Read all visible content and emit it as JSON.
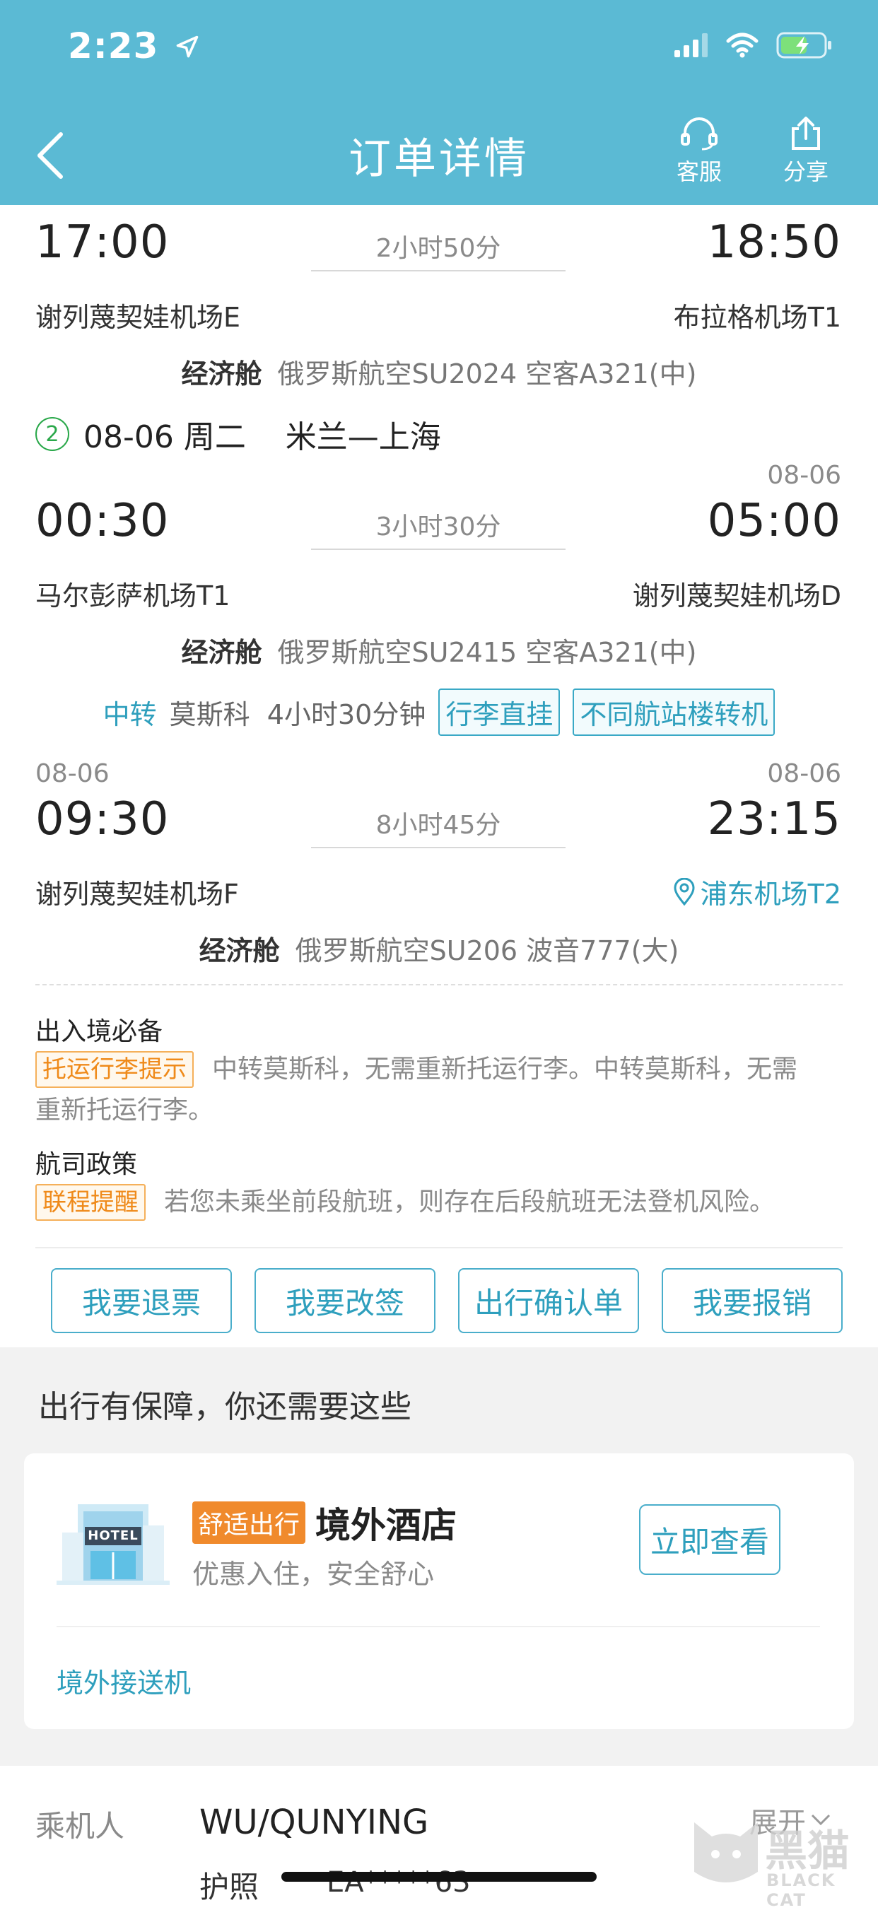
{
  "status": {
    "time": "2:23"
  },
  "header": {
    "title": "订单详情",
    "service_label": "客服",
    "share_label": "分享"
  },
  "segment1": {
    "dep_time": "17:00",
    "arr_time": "18:50",
    "duration": "2小时50分",
    "dep_airport": "谢列蔑契娃机场E",
    "arr_airport": "布拉格机场T1",
    "cabin": "经济舱",
    "flight": "俄罗斯航空SU2024  空客A321(中)"
  },
  "trip2": {
    "index": "2",
    "label": "08-06 周二    米兰—上海"
  },
  "segment2": {
    "arr_date": "08-06",
    "dep_time": "00:30",
    "arr_time": "05:00",
    "duration": "3小时30分",
    "dep_airport": "马尔彭萨机场T1",
    "arr_airport": "谢列蔑契娃机场D",
    "cabin": "经济舱",
    "flight": "俄罗斯航空SU2415  空客A321(中)"
  },
  "transfer": {
    "label": "中转",
    "info": "莫斯科  4小时30分钟",
    "tag1": "行李直挂",
    "tag2": "不同航站楼转机"
  },
  "segment3": {
    "dep_date": "08-06",
    "arr_date": "08-06",
    "dep_time": "09:30",
    "arr_time": "23:15",
    "duration": "8小时45分",
    "dep_airport": "谢列蔑契娃机场F",
    "arr_airport": "浦东机场T2",
    "cabin": "经济舱",
    "flight": "俄罗斯航空SU206  波音777(大)"
  },
  "notes": {
    "entry_title": "出入境必备",
    "baggage_tag": "托运行李提示",
    "baggage_text_1": "中转莫斯科，无需重新托运行李。中转莫斯科，无需",
    "baggage_text_2": "重新托运行李。",
    "policy_title": "航司政策",
    "policy_tag": "联程提醒",
    "policy_text": "若您未乘坐前段航班，则存在后段航班无法登机风险。"
  },
  "actions": {
    "refund": "我要退票",
    "change": "我要改签",
    "confirm": "出行确认单",
    "reimburse": "我要报销"
  },
  "extras": {
    "heading": "出行有保障，你还需要这些",
    "hotel_tag": "舒适出行",
    "hotel_title": "境外酒店",
    "hotel_sub": "优惠入住，安全舒心",
    "hotel_button": "立即查看",
    "hotel_logo_text": "HOTEL",
    "transfer_link": "境外接送机"
  },
  "passenger": {
    "label": "乘机人",
    "name": "WU/QUNYING",
    "expand": "展开",
    "doc_label": "护照",
    "doc_number": "EA*****63"
  },
  "watermark": {
    "cn": "黑猫",
    "en": "BLACK CAT"
  }
}
